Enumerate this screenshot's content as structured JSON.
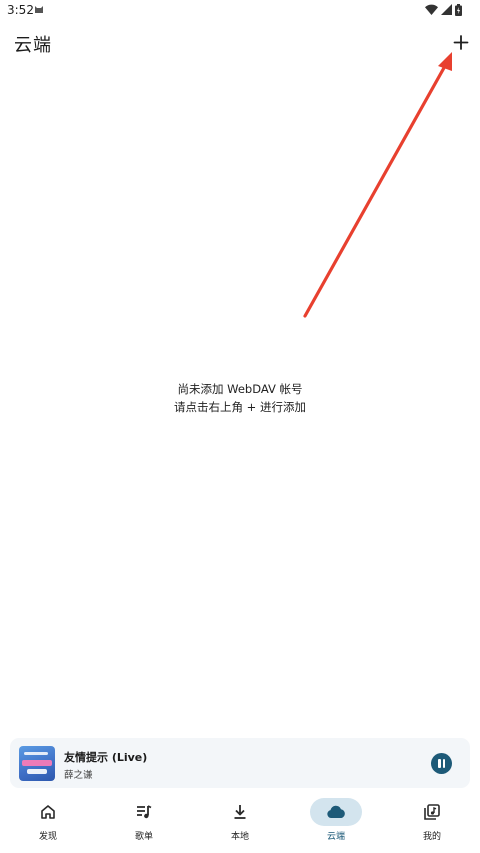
{
  "status_bar": {
    "time": "3:52"
  },
  "header": {
    "title": "云端",
    "add_icon": "plus-icon"
  },
  "empty_state": {
    "line1": "尚未添加 WebDAV 帐号",
    "line2": "请点击右上角 + 进行添加"
  },
  "player": {
    "title": "友情提示 (Live)",
    "artist": "薛之谦",
    "state_icon": "pause-icon"
  },
  "nav": {
    "items": [
      {
        "label": "发现",
        "icon": "home-icon"
      },
      {
        "label": "歌单",
        "icon": "playlist-icon"
      },
      {
        "label": "本地",
        "icon": "download-icon"
      },
      {
        "label": "云端",
        "icon": "cloud-icon",
        "active": true
      },
      {
        "label": "我的",
        "icon": "library-icon"
      }
    ]
  },
  "colors": {
    "accent": "#1d5a78",
    "active_indicator": "#d3e4ee",
    "annotation_arrow": "#e8402f",
    "player_bg": "#f3f6f9"
  }
}
